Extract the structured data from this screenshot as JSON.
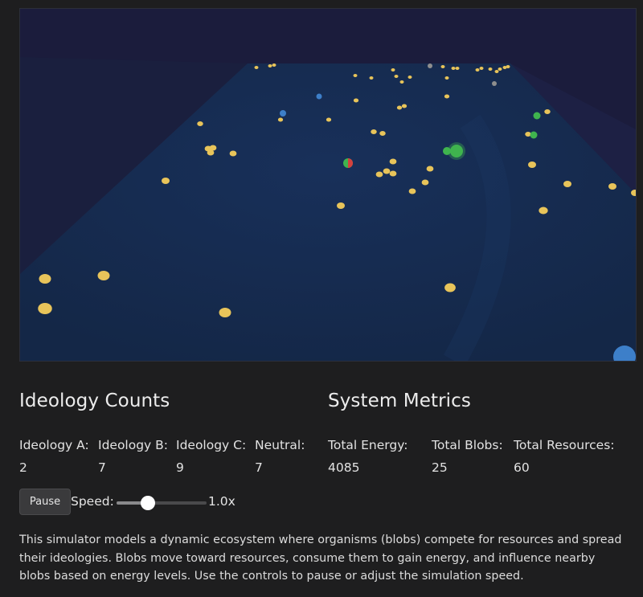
{
  "scene": {
    "colors": {
      "backdrop": "#1b1c3c",
      "floor": "#142747",
      "walls": "#1b2140",
      "resource": "#e8c45a",
      "ideology_a": "#d4413e",
      "ideology_b": "#3d7fc9",
      "ideology_c": "#3fb44e",
      "neutral": "#8e8e8e"
    },
    "blobs": [
      {
        "ideology": "ideology_a",
        "note": "red-green blob near center"
      },
      {
        "ideology": "ideology_b"
      },
      {
        "ideology": "ideology_c"
      },
      {
        "ideology": "neutral"
      }
    ]
  },
  "ideology": {
    "title": "Ideology Counts",
    "items": [
      {
        "label": "Ideology A:",
        "value": "2"
      },
      {
        "label": "Ideology B:",
        "value": "7"
      },
      {
        "label": "Ideology C:",
        "value": "9"
      },
      {
        "label": "Neutral:",
        "value": "7"
      }
    ]
  },
  "metrics": {
    "title": "System Metrics",
    "items": [
      {
        "label": "Total Energy:",
        "value": "4085"
      },
      {
        "label": "Total Blobs:",
        "value": "25"
      },
      {
        "label": "Total Resources:",
        "value": "60"
      }
    ]
  },
  "controls": {
    "pause_label": "Pause",
    "speed_label": "Speed:",
    "speed_value": "1.0x",
    "speed_fraction": 0.35
  },
  "description": "This simulator models a dynamic ecosystem where organisms (blobs) compete for resources and spread their ideologies. Blobs move toward resources, consume them to gain energy, and influence nearby blobs based on energy levels. Use the controls to pause or adjust the simulation speed."
}
